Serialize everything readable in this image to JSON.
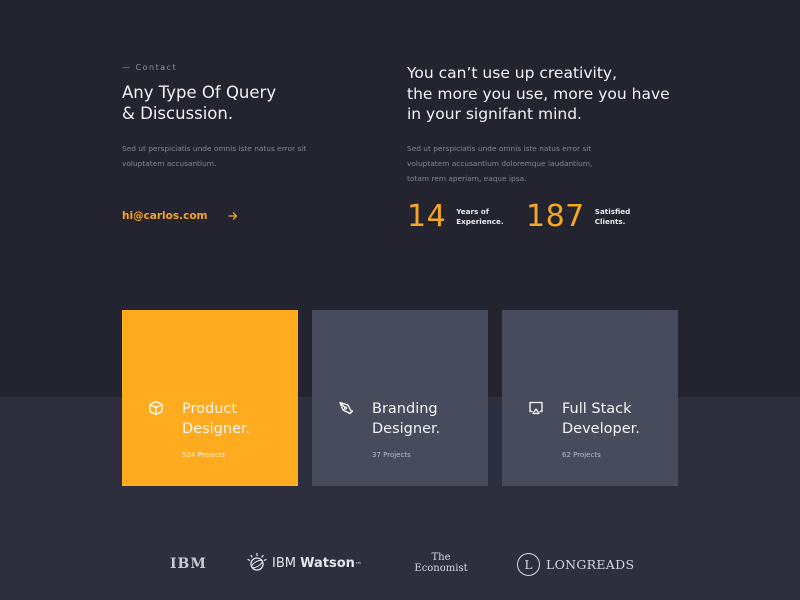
{
  "contact": {
    "kicker": "— Contact",
    "title_line1": "Any Type Of Query",
    "title_line2": "& Discussion.",
    "description": "Sed ut perspiciatis unde omnis iste natus error sit voluptatem accusantium.",
    "email": "hi@carlos.com",
    "arrow_icon": "arrow-right-icon"
  },
  "about": {
    "quote_line1": "You can’t use up creativity,",
    "quote_line2": "the more you use, more you have",
    "quote_line3": "in your signifant mind.",
    "description": "Sed ut perspiciatis unde omnis iste natus error sit voluptatem accusantium doloremque laudantium, totam rem aperiam, eaque ipsa.",
    "stats": [
      {
        "value": "14",
        "label_line1": "Years of",
        "label_line2": "Experience."
      },
      {
        "value": "187",
        "label_line1": "Satisfied",
        "label_line2": "Clients."
      }
    ]
  },
  "services": [
    {
      "title_line1": "Product",
      "title_line2": "Designer.",
      "projects": "524 Projects",
      "icon": "cube-icon",
      "active": true
    },
    {
      "title_line1": "Branding",
      "title_line2": "Designer.",
      "projects": "37 Projects",
      "icon": "pen-nib-icon",
      "active": false
    },
    {
      "title_line1": "Full Stack",
      "title_line2": "Developer.",
      "projects": "62 Projects",
      "icon": "monitor-icon",
      "active": false
    }
  ],
  "clients": {
    "ibm": "IBM",
    "watson_brand": "IBM",
    "watson_product": "Watson",
    "watson_mark": "™",
    "economist_line1": "The",
    "economist_line2": "Economist",
    "longreads_letter": "L",
    "longreads": "LONGREADS"
  },
  "colors": {
    "background": "#23242f",
    "accent": "#f5a623",
    "card": "#474b5c",
    "card_active": "#ffab20"
  }
}
